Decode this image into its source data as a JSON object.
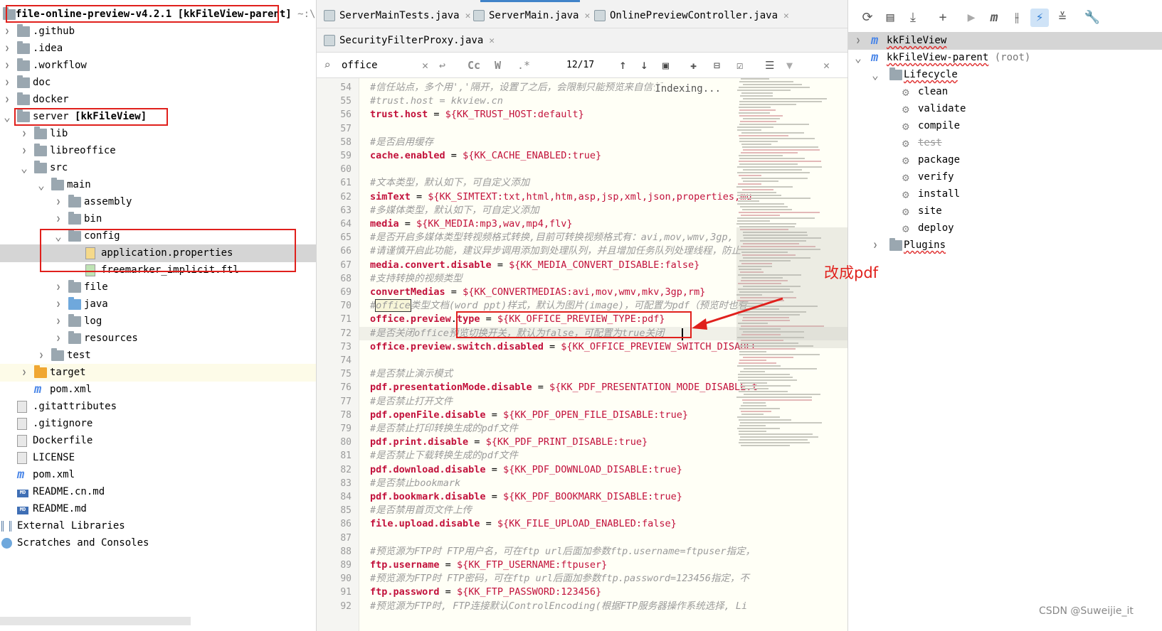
{
  "tree": {
    "root_label": "file-online-preview-v4.2.1",
    "root_module": "[kkFileView-parent]",
    "root_path": "~:\\code",
    "items": [
      {
        "label": "file-online-preview-v4.2.1 [kkFileView-parent]",
        "type": "root"
      },
      {
        "label": ".github",
        "type": "folder"
      },
      {
        "label": ".idea",
        "type": "folder"
      },
      {
        "label": ".workflow",
        "type": "folder"
      },
      {
        "label": "doc",
        "type": "folder"
      },
      {
        "label": "docker",
        "type": "folder"
      },
      {
        "label": "server",
        "module": "[kkFileView]",
        "type": "module"
      },
      {
        "label": "lib",
        "type": "folder"
      },
      {
        "label": "libreoffice",
        "type": "folder"
      },
      {
        "label": "src",
        "type": "folder"
      },
      {
        "label": "main",
        "type": "folder"
      },
      {
        "label": "assembly",
        "type": "folder"
      },
      {
        "label": "bin",
        "type": "folder"
      },
      {
        "label": "config",
        "type": "folder"
      },
      {
        "label": "application.properties",
        "type": "file"
      },
      {
        "label": "freemarker_implicit.ftl",
        "type": "file"
      },
      {
        "label": "file",
        "type": "folder"
      },
      {
        "label": "java",
        "type": "folder"
      },
      {
        "label": "log",
        "type": "folder"
      },
      {
        "label": "resources",
        "type": "folder"
      },
      {
        "label": "test",
        "type": "folder"
      },
      {
        "label": "target",
        "type": "folder"
      },
      {
        "label": "pom.xml",
        "type": "maven"
      },
      {
        "label": ".gitattributes",
        "type": "file"
      },
      {
        "label": ".gitignore",
        "type": "file"
      },
      {
        "label": "Dockerfile",
        "type": "file"
      },
      {
        "label": "LICENSE",
        "type": "file"
      },
      {
        "label": "pom.xml",
        "type": "maven"
      },
      {
        "label": "README.cn.md",
        "type": "md"
      },
      {
        "label": "README.md",
        "type": "md"
      },
      {
        "label": "External Libraries",
        "type": "lib"
      },
      {
        "label": "Scratches and Consoles",
        "type": "scratch"
      }
    ]
  },
  "tabs": {
    "row1": [
      {
        "label": "ServerMainTests.java"
      },
      {
        "label": "ServerMain.java"
      },
      {
        "label": "OnlinePreviewController.java"
      }
    ],
    "row2": [
      {
        "label": "SecurityFilterProxy.java"
      }
    ]
  },
  "find": {
    "query": "office",
    "match_count": "12/17",
    "case_label": "Cc",
    "word_label": "W",
    "regex_label": ".*"
  },
  "editor": {
    "status": "Indexing...",
    "lines": [
      {
        "n": "54",
        "parts": [
          {
            "t": "#信任站点，多个用','隔开，设置了之后，会限制只能预览来自信任",
            "c": "cmt"
          }
        ]
      },
      {
        "n": "55",
        "parts": [
          {
            "t": "#trust.host = kkview.cn",
            "c": "cmt"
          }
        ]
      },
      {
        "n": "56",
        "parts": [
          {
            "t": "trust.host",
            "c": "key"
          },
          {
            "t": " = ",
            "c": ""
          },
          {
            "t": "${KK_TRUST_HOST:default}",
            "c": "val"
          }
        ]
      },
      {
        "n": "57",
        "parts": []
      },
      {
        "n": "58",
        "parts": [
          {
            "t": "#是否启用缓存",
            "c": "cmt"
          }
        ]
      },
      {
        "n": "59",
        "parts": [
          {
            "t": "cache.enabled",
            "c": "key"
          },
          {
            "t": " = ",
            "c": ""
          },
          {
            "t": "${KK_CACHE_ENABLED:true}",
            "c": "val"
          }
        ]
      },
      {
        "n": "60",
        "parts": []
      },
      {
        "n": "61",
        "parts": [
          {
            "t": "#文本类型，默认如下，可自定义添加",
            "c": "cmt"
          }
        ]
      },
      {
        "n": "62",
        "parts": [
          {
            "t": "simText",
            "c": "key"
          },
          {
            "t": " = ",
            "c": ""
          },
          {
            "t": "${KK_SIMTEXT:txt,html,htm,asp,jsp,xml,json,properties,mu",
            "c": "val"
          }
        ]
      },
      {
        "n": "63",
        "parts": [
          {
            "t": "#多媒体类型，默认如下，可自定义添加",
            "c": "cmt"
          }
        ]
      },
      {
        "n": "64",
        "parts": [
          {
            "t": "media",
            "c": "key"
          },
          {
            "t": " = ",
            "c": ""
          },
          {
            "t": "${KK_MEDIA:mp3,wav,mp4,flv}",
            "c": "val"
          }
        ]
      },
      {
        "n": "65",
        "parts": [
          {
            "t": "#是否开启多媒体类型转视频格式转换,目前可转换视频格式有：avi,mov,wmv,3gp,",
            "c": "cmt"
          }
        ]
      },
      {
        "n": "66",
        "parts": [
          {
            "t": "#请谨慎开启此功能，建议异步调用添加到处理队列，并且增加任务队列处理线程，防止",
            "c": "cmt"
          }
        ]
      },
      {
        "n": "67",
        "parts": [
          {
            "t": "media.convert.disable",
            "c": "key"
          },
          {
            "t": " = ",
            "c": ""
          },
          {
            "t": "${KK_MEDIA_CONVERT_DISABLE:false}",
            "c": "val"
          }
        ]
      },
      {
        "n": "68",
        "parts": [
          {
            "t": "#支持转换的视频类型",
            "c": "cmt"
          }
        ]
      },
      {
        "n": "69",
        "parts": [
          {
            "t": "convertMedias",
            "c": "key"
          },
          {
            "t": " = ",
            "c": ""
          },
          {
            "t": "${KK_CONVERTMEDIAS:avi,mov,wmv,mkv,3gp,rm}",
            "c": "val"
          }
        ]
      },
      {
        "n": "70",
        "parts": [
          {
            "t": "#",
            "c": "cmt"
          },
          {
            "t": "office",
            "c": "cmt match"
          },
          {
            "t": "类型文档(word ppt)样式，默认为图片(image)，可配置为pdf（预览时也有",
            "c": "cmt"
          }
        ]
      },
      {
        "n": "71",
        "parts": [
          {
            "t": "office.preview",
            "c": "key"
          },
          {
            "t": ".",
            "c": ""
          },
          {
            "t": "type",
            "c": "key"
          },
          {
            "t": " = ",
            "c": ""
          },
          {
            "t": "${KK_OFFICE_PREVIEW_TYPE:pdf}",
            "c": "val"
          }
        ]
      },
      {
        "n": "72",
        "parts": [
          {
            "t": "#是否关闭office预览切换开关，默认为false，可配置为true关闭",
            "c": "cmt"
          }
        ]
      },
      {
        "n": "73",
        "parts": [
          {
            "t": "office.preview.switch.disabled",
            "c": "key"
          },
          {
            "t": " = ",
            "c": ""
          },
          {
            "t": "${KK_OFFICE_PREVIEW_SWITCH_DISABLE",
            "c": "val"
          }
        ]
      },
      {
        "n": "74",
        "parts": []
      },
      {
        "n": "75",
        "parts": [
          {
            "t": "#是否禁止演示模式",
            "c": "cmt"
          }
        ]
      },
      {
        "n": "76",
        "parts": [
          {
            "t": "pdf.presentationMode.disable",
            "c": "key"
          },
          {
            "t": " = ",
            "c": ""
          },
          {
            "t": "${KK_PDF_PRESENTATION_MODE_DISABLE:t",
            "c": "val"
          }
        ]
      },
      {
        "n": "77",
        "parts": [
          {
            "t": "#是否禁止打开文件",
            "c": "cmt"
          }
        ]
      },
      {
        "n": "78",
        "parts": [
          {
            "t": "pdf.openFile.disable",
            "c": "key"
          },
          {
            "t": " = ",
            "c": ""
          },
          {
            "t": "${KK_PDF_OPEN_FILE_DISABLE:true}",
            "c": "val"
          }
        ]
      },
      {
        "n": "79",
        "parts": [
          {
            "t": "#是否禁止打印转换生成的pdf文件",
            "c": "cmt"
          }
        ]
      },
      {
        "n": "80",
        "parts": [
          {
            "t": "pdf.print.disable",
            "c": "key"
          },
          {
            "t": " = ",
            "c": ""
          },
          {
            "t": "${KK_PDF_PRINT_DISABLE:true}",
            "c": "val"
          }
        ]
      },
      {
        "n": "81",
        "parts": [
          {
            "t": "#是否禁止下载转换生成的pdf文件",
            "c": "cmt"
          }
        ]
      },
      {
        "n": "82",
        "parts": [
          {
            "t": "pdf.download.disable",
            "c": "key"
          },
          {
            "t": " = ",
            "c": ""
          },
          {
            "t": "${KK_PDF_DOWNLOAD_DISABLE:true}",
            "c": "val"
          }
        ]
      },
      {
        "n": "83",
        "parts": [
          {
            "t": "#是否禁止bookmark",
            "c": "cmt"
          }
        ]
      },
      {
        "n": "84",
        "parts": [
          {
            "t": "pdf.bookmark.disable",
            "c": "key"
          },
          {
            "t": " = ",
            "c": ""
          },
          {
            "t": "${KK_PDF_BOOKMARK_DISABLE:true}",
            "c": "val"
          }
        ]
      },
      {
        "n": "85",
        "parts": [
          {
            "t": "#是否禁用首页文件上传",
            "c": "cmt"
          }
        ]
      },
      {
        "n": "86",
        "parts": [
          {
            "t": "file.upload.disable",
            "c": "key"
          },
          {
            "t": " = ",
            "c": ""
          },
          {
            "t": "${KK_FILE_UPLOAD_ENABLED:false}",
            "c": "val"
          }
        ]
      },
      {
        "n": "87",
        "parts": []
      },
      {
        "n": "88",
        "parts": [
          {
            "t": "#预览源为FTP时 FTP用户名，可在ftp url后面加参数ftp.username=ftpuser指定，",
            "c": "cmt"
          }
        ]
      },
      {
        "n": "89",
        "parts": [
          {
            "t": "ftp.username",
            "c": "key"
          },
          {
            "t": " = ",
            "c": ""
          },
          {
            "t": "${KK_FTP_USERNAME:ftpuser}",
            "c": "val"
          }
        ]
      },
      {
        "n": "90",
        "parts": [
          {
            "t": "#预览源为FTP时 FTP密码，可在ftp url后面加参数ftp.password=123456指定，不",
            "c": "cmt"
          }
        ]
      },
      {
        "n": "91",
        "parts": [
          {
            "t": "ftp.password",
            "c": "key"
          },
          {
            "t": " = ",
            "c": ""
          },
          {
            "t": "${KK_FTP_PASSWORD:123456}",
            "c": "val"
          }
        ]
      },
      {
        "n": "92",
        "parts": [
          {
            "t": "#预览源为FTP时, FTP连接默认ControlEncoding(根据FTP服务器操作系统选择, Li",
            "c": "cmt"
          }
        ]
      }
    ]
  },
  "maven": {
    "toolbar_icons": [
      "refresh-icon",
      "reimport-icon",
      "download-icon",
      "add-icon",
      "run-icon",
      "maven-goal-icon",
      "toggle-skip-tests-icon",
      "offline-mode-icon",
      "collapse-all-icon",
      "settings-icon"
    ],
    "items": [
      {
        "label": "kkFileView",
        "level": 0,
        "extra": ""
      },
      {
        "label": "kkFileView-parent",
        "level": 0,
        "extra": "(root)"
      },
      {
        "label": "Lifecycle",
        "level": 1,
        "extra": ""
      },
      {
        "label": "clean",
        "level": 2,
        "extra": ""
      },
      {
        "label": "validate",
        "level": 2,
        "extra": ""
      },
      {
        "label": "compile",
        "level": 2,
        "extra": ""
      },
      {
        "label": "test",
        "level": 2,
        "extra": ""
      },
      {
        "label": "package",
        "level": 2,
        "extra": ""
      },
      {
        "label": "verify",
        "level": 2,
        "extra": ""
      },
      {
        "label": "install",
        "level": 2,
        "extra": ""
      },
      {
        "label": "site",
        "level": 2,
        "extra": ""
      },
      {
        "label": "deploy",
        "level": 2,
        "extra": ""
      },
      {
        "label": "Plugins",
        "level": 1,
        "extra": ""
      }
    ]
  },
  "annotation": {
    "text": "改成pdf",
    "color": "#e0201c"
  },
  "watermark": "CSDN @Suweijie_it"
}
